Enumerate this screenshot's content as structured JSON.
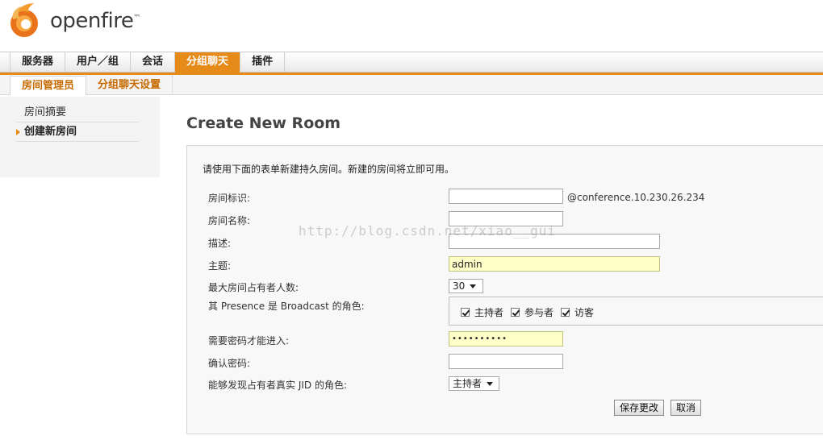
{
  "app": {
    "logo_text": "openfire",
    "logo_tm": "™"
  },
  "main_nav": [
    "服务器",
    "用户／组",
    "会话",
    "分组聊天",
    "插件"
  ],
  "sub_nav": [
    "房间管理员",
    "分组聊天设置"
  ],
  "sidebar": {
    "items": [
      "房间摘要",
      "创建新房间"
    ]
  },
  "page": {
    "title": "Create New Room",
    "intro": "请使用下面的表单新建持久房间。新建的房间将立即可用。"
  },
  "form": {
    "room_id_label": "房间标识:",
    "room_id_value": "",
    "room_id_suffix": "@conference.10.230.26.234",
    "room_name_label": "房间名称:",
    "room_name_value": "",
    "description_label": "描述:",
    "description_value": "",
    "subject_label": "主题:",
    "subject_value": "admin",
    "max_occupants_label": "最大房间占有者人数:",
    "max_occupants_value": "30",
    "broadcast_label": "其 Presence 是 Broadcast 的角色:",
    "roles": [
      "主持者",
      "参与者",
      "访客"
    ],
    "password_label": "需要密码才能进入:",
    "password_value": "••••••••••",
    "confirm_password_label": "确认密码:",
    "confirm_password_value": "",
    "discover_jid_label": "能够发现占有者真实 JID 的角色:",
    "discover_jid_value": "主持者",
    "save_label": "保存更改",
    "cancel_label": "取消"
  },
  "watermark": "http://blog.csdn.net/xiao__gui",
  "colors": {
    "accent": "#e68a1a",
    "field_highlight": "#ffffc8"
  }
}
